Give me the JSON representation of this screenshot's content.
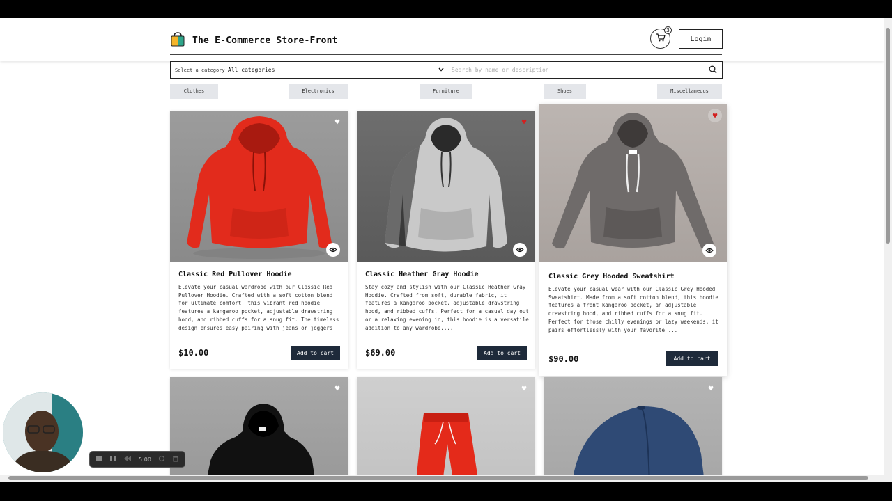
{
  "header": {
    "title": "The E-Commerce Store-Front",
    "cart_count": "3",
    "login_label": "Login"
  },
  "search": {
    "category_label": "Select a category",
    "category_value": "All categories",
    "placeholder": "Search by name or description"
  },
  "categories": [
    "Clothes",
    "Electronics",
    "Furniture",
    "Shoes",
    "Miscellaneous"
  ],
  "products": [
    {
      "title": "Classic Red Pullover Hoodie",
      "description": "Elevate your casual wardrobe with our Classic Red Pullover Hoodie. Crafted with a soft cotton blend for ultimate comfort, this vibrant red hoodie features a kangaroo pocket, adjustable drawstring hood, and ribbed cuffs for a snug fit. The timeless design ensures easy pairing with jeans or joggers fo...",
      "price": "$10.00",
      "favorited": false,
      "add_label": "Add to cart"
    },
    {
      "title": "Classic Heather Gray Hoodie",
      "description": "Stay cozy and stylish with our Classic Heather Gray Hoodie. Crafted from soft, durable fabric, it features a kangaroo pocket, adjustable drawstring hood, and ribbed cuffs. Perfect for a casual day out or a relaxing evening in, this hoodie is a versatile addition to any wardrobe....",
      "price": "$69.00",
      "favorited": true,
      "add_label": "Add to cart"
    },
    {
      "title": "Classic Grey Hooded Sweatshirt",
      "description": "Elevate your casual wear with our Classic Grey Hooded Sweatshirt. Made from a soft cotton blend, this hoodie features a front kangaroo pocket, an adjustable drawstring hood, and ribbed cuffs for a snug fit. Perfect for those chilly evenings or lazy weekends, it pairs effortlessly with your favorite ...",
      "price": "$90.00",
      "favorited": true,
      "add_label": "Add to cart"
    },
    {
      "favorited": false
    },
    {
      "favorited": false
    },
    {
      "favorited": false
    }
  ],
  "recorder": {
    "time": "5:00"
  },
  "colors": {
    "accent_button": "#1e2a3a",
    "favorite_active": "#d32020",
    "chip_bg": "#e4e6ea"
  },
  "icons": {
    "logo": "shopping-bag-icon",
    "cart": "cart-icon",
    "search": "search-icon",
    "favorite": "heart-icon",
    "preview": "eye-icon"
  }
}
